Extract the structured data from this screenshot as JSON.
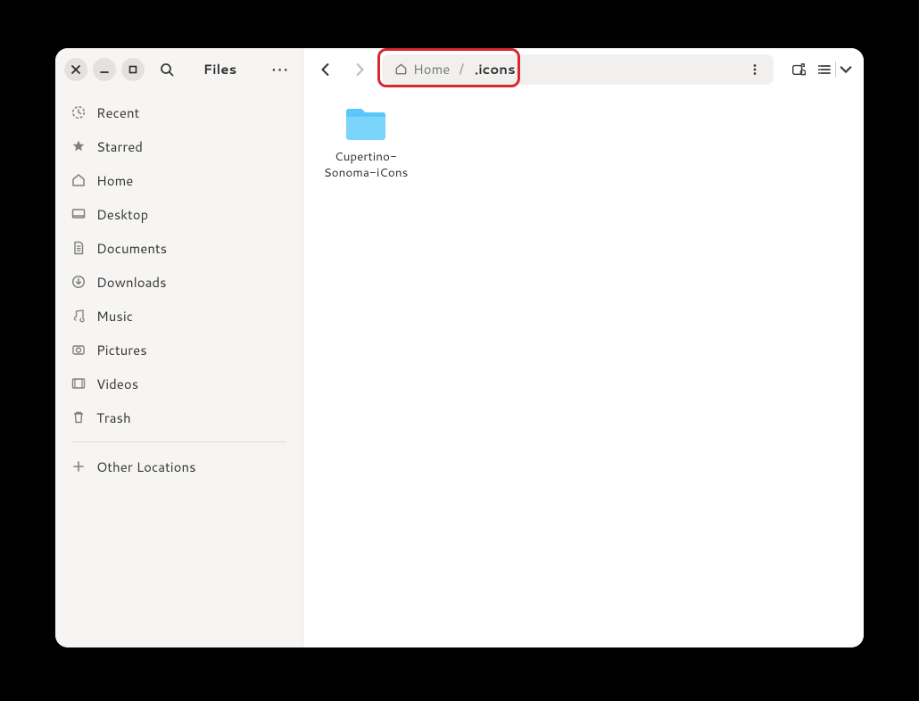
{
  "app_title": "Files",
  "sidebar": {
    "items": [
      {
        "icon": "recent",
        "label": "Recent"
      },
      {
        "icon": "star",
        "label": "Starred"
      },
      {
        "icon": "home",
        "label": "Home"
      },
      {
        "icon": "desktop",
        "label": "Desktop"
      },
      {
        "icon": "documents",
        "label": "Documents"
      },
      {
        "icon": "downloads",
        "label": "Downloads"
      },
      {
        "icon": "music",
        "label": "Music"
      },
      {
        "icon": "pictures",
        "label": "Pictures"
      },
      {
        "icon": "videos",
        "label": "Videos"
      },
      {
        "icon": "trash",
        "label": "Trash"
      }
    ],
    "other_locations": "Other Locations"
  },
  "breadcrumb": {
    "home": "Home",
    "separator": "/",
    "current": ".icons"
  },
  "content": {
    "items": [
      {
        "name": "Cupertino-Sonoma-iCons"
      }
    ]
  }
}
